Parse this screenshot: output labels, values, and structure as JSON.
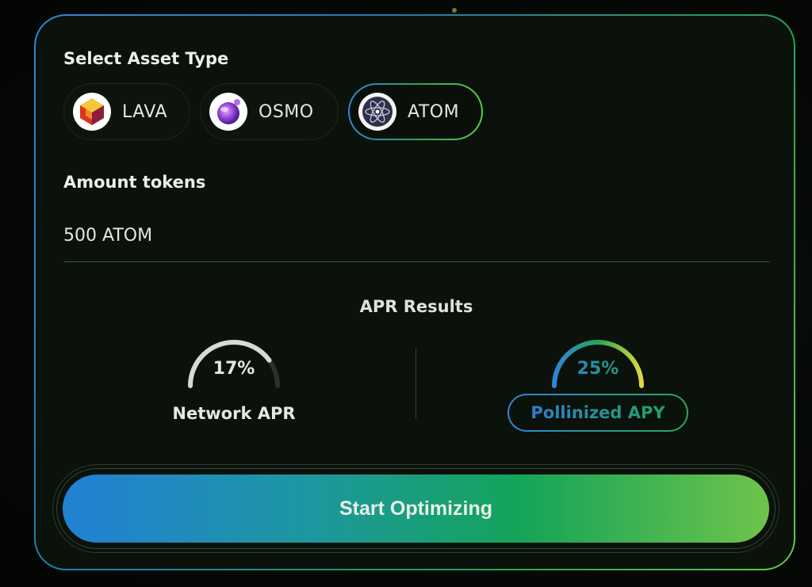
{
  "form": {
    "asset_label": "Select Asset Type",
    "assets": [
      {
        "name": "LAVA",
        "icon": "lava-icon",
        "selected": false
      },
      {
        "name": "OSMO",
        "icon": "osmo-icon",
        "selected": false
      },
      {
        "name": "ATOM",
        "icon": "atom-icon",
        "selected": true
      }
    ],
    "amount_label": "Amount tokens",
    "amount_value": "500 ATOM"
  },
  "results": {
    "title": "APR Results",
    "network": {
      "value": "17%",
      "percent": 17,
      "label": "Network APR"
    },
    "pollinized": {
      "value": "25%",
      "percent": 25,
      "label": "Pollinized APY"
    }
  },
  "cta": {
    "label": "Start Optimizing"
  },
  "colors": {
    "accent_blue": "#2f86d8",
    "accent_green": "#5ec94a",
    "card_bg": "#0b110b"
  }
}
